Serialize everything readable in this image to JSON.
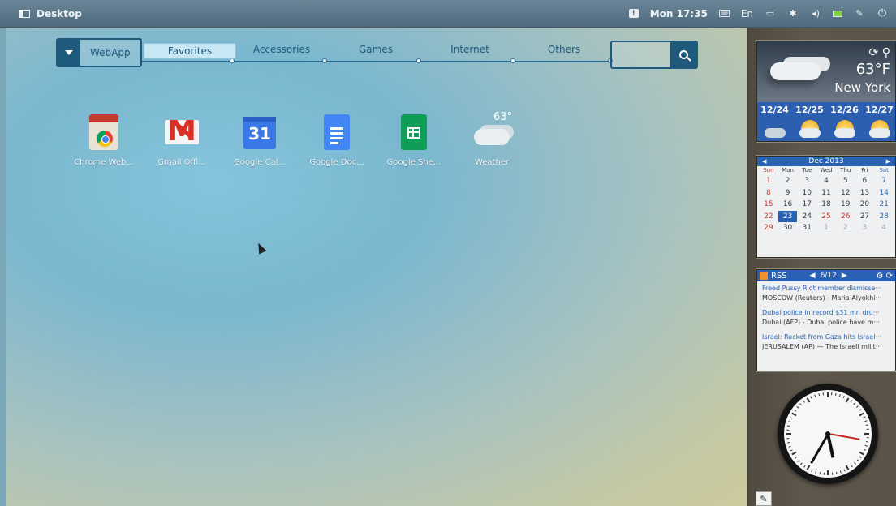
{
  "topbar": {
    "desktop_label": "Desktop",
    "clock": "Mon 17:35",
    "lang": "En",
    "icons": [
      "notification-icon",
      "keyboard-icon",
      "display-icon",
      "bluetooth-icon",
      "volume-icon",
      "battery-icon",
      "pen-icon",
      "power-icon"
    ]
  },
  "launcher": {
    "webapp_label": "WebApp",
    "tabs": [
      "Favorites",
      "Accessories",
      "Games",
      "Internet",
      "Others"
    ],
    "active_tab": "Favorites",
    "search_placeholder": ""
  },
  "apps": [
    {
      "label": "Chrome Web...",
      "icon": "chrome-webstore-icon"
    },
    {
      "label": "Gmail Offl...",
      "icon": "gmail-icon"
    },
    {
      "label": "Google Cal...",
      "icon": "google-calendar-icon",
      "badge": "31"
    },
    {
      "label": "Google Doc...",
      "icon": "google-docs-icon"
    },
    {
      "label": "Google She...",
      "icon": "google-sheets-icon"
    },
    {
      "label": "Weather",
      "icon": "weather-icon",
      "temp": "63°"
    }
  ],
  "weather_widget": {
    "temp": "63°F",
    "city": "New York",
    "dates": [
      "12/24",
      "12/25",
      "12/26",
      "12/27"
    ]
  },
  "calendar_widget": {
    "month": "Dec 2013",
    "day_names": [
      "Sun",
      "Mon",
      "Tue",
      "Wed",
      "Thu",
      "Fri",
      "Sat"
    ],
    "days": [
      "1",
      "2",
      "3",
      "4",
      "5",
      "6",
      "7",
      "8",
      "9",
      "10",
      "11",
      "12",
      "13",
      "14",
      "15",
      "16",
      "17",
      "18",
      "19",
      "20",
      "21",
      "22",
      "23",
      "24",
      "25",
      "26",
      "27",
      "28",
      "29",
      "30",
      "31",
      "1",
      "2",
      "3",
      "4"
    ],
    "today": "23"
  },
  "rss_widget": {
    "title": "RSS",
    "counter": "6/12",
    "items": [
      {
        "title": "Freed Pussy Riot member dismisse···",
        "snippet": "MOSCOW (Reuters) - Maria Alyokhi···"
      },
      {
        "title": "Dubai police in record $31 mn dru···",
        "snippet": "Dubai (AFP) - Dubai police have m···"
      },
      {
        "title": "Israel: Rocket from Gaza hits Israel···",
        "snippet": "JERUSALEM (AP) — The Israeli milit···"
      }
    ]
  },
  "clock_widget": {
    "hour": 5,
    "minute": 35
  },
  "colors": {
    "accent": "#1f5a7c",
    "widget_blue": "#2a62b3",
    "sunday_red": "#c53a2e"
  }
}
